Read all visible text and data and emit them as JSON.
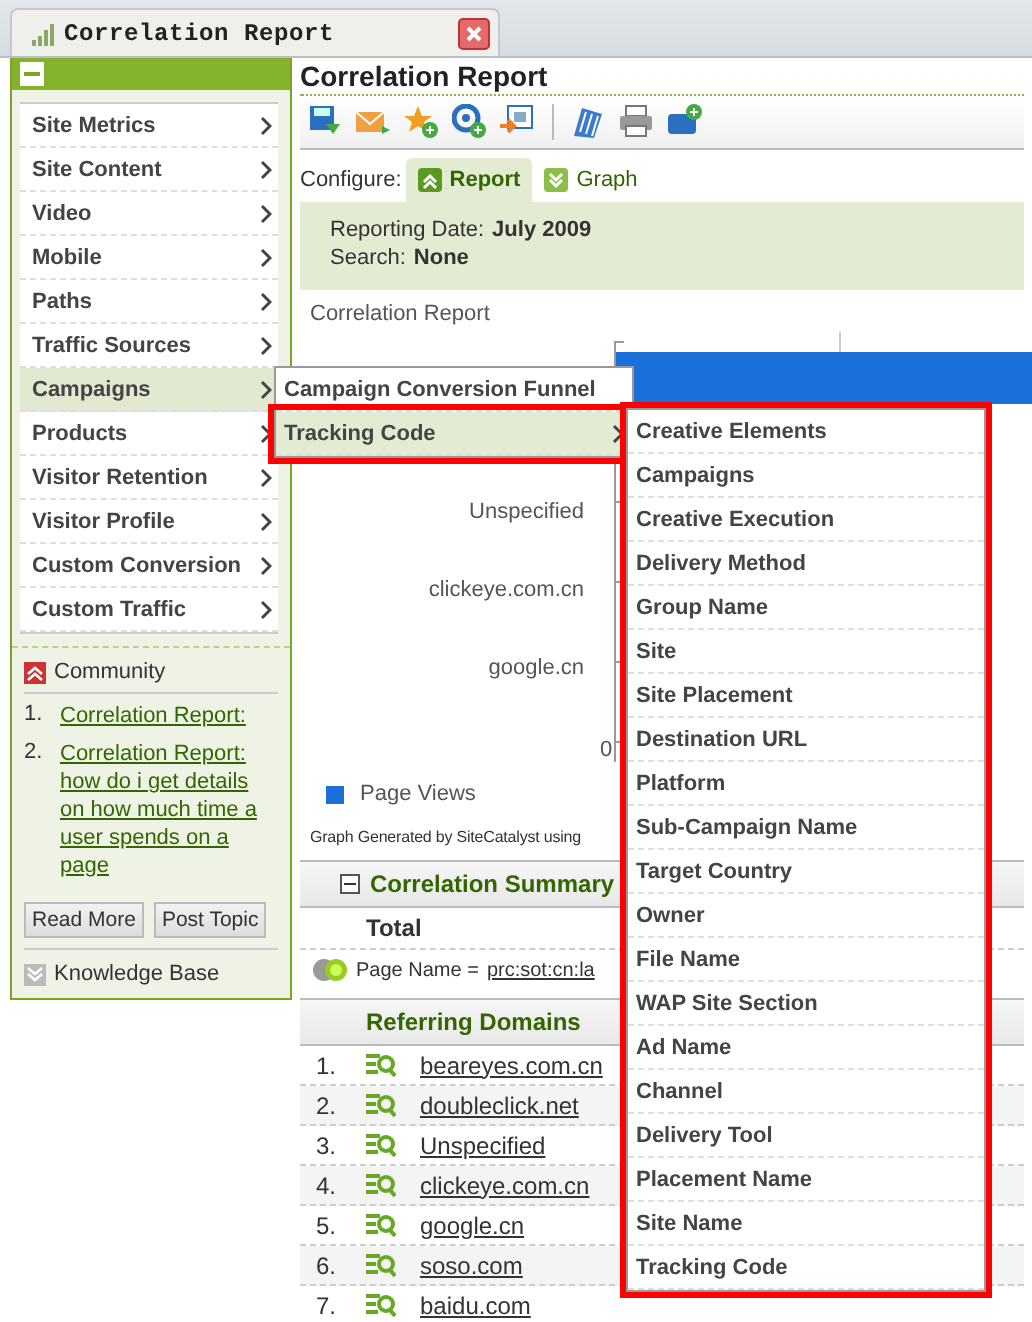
{
  "tab": {
    "title": "Correlation Report"
  },
  "sidebar": {
    "items": [
      {
        "label": "Site Metrics",
        "selected": false
      },
      {
        "label": "Site Content",
        "selected": false
      },
      {
        "label": "Video",
        "selected": false
      },
      {
        "label": "Mobile",
        "selected": false
      },
      {
        "label": "Paths",
        "selected": false
      },
      {
        "label": "Traffic Sources",
        "selected": false
      },
      {
        "label": "Campaigns",
        "selected": true
      },
      {
        "label": "Products",
        "selected": false
      },
      {
        "label": "Visitor Retention",
        "selected": false
      },
      {
        "label": "Visitor Profile",
        "selected": false
      },
      {
        "label": "Custom Conversion",
        "selected": false
      },
      {
        "label": "Custom Traffic",
        "selected": false
      }
    ],
    "community": {
      "title": "Community",
      "links": [
        {
          "number": "1.",
          "text": "Correlation Report:"
        },
        {
          "number": "2.",
          "text": "Correlation Report: how do i get details on how much time a user spends on a page"
        }
      ]
    },
    "buttons": [
      "Read More",
      "Post Topic"
    ],
    "knowledge_base": "Knowledge Base"
  },
  "main": {
    "title": "Correlation Report",
    "configure": {
      "label": "Configure:",
      "tabs": [
        {
          "label": "Report",
          "selected": true
        },
        {
          "label": "Graph",
          "selected": false
        }
      ]
    },
    "info": [
      {
        "label": "Reporting Date:",
        "value": "July 2009"
      },
      {
        "label": "Search:",
        "value": "None"
      }
    ],
    "chart": {
      "title": "Correlation Report",
      "labels": [
        "Unspecified",
        "clickeye.com.cn",
        "google.cn"
      ],
      "tick": "0",
      "legend": "Page Views",
      "footer": "Graph Generated by SiteCatalyst using"
    },
    "summary": {
      "title": "Correlation Summary",
      "total": "Total",
      "page_name_label": "Page Name =",
      "page_name_value": "prc:sot:cn:la"
    },
    "domains": {
      "title": "Referring Domains",
      "rows": [
        {
          "number": "1.",
          "name": "beareyes.com.cn"
        },
        {
          "number": "2.",
          "name": "doubleclick.net"
        },
        {
          "number": "3.",
          "name": "Unspecified"
        },
        {
          "number": "4.",
          "name": "clickeye.com.cn"
        },
        {
          "number": "5.",
          "name": "google.cn"
        },
        {
          "number": "6.",
          "name": "soso.com"
        },
        {
          "number": "7.",
          "name": "baidu.com"
        }
      ]
    }
  },
  "menus": [
    {
      "highlighted": false,
      "items": [
        {
          "label": "Campaign Conversion Funnel",
          "selected": false,
          "highlighted": false,
          "has_submenu": false
        },
        {
          "label": "Tracking Code",
          "selected": true,
          "highlighted": true,
          "has_submenu": true
        }
      ]
    },
    {
      "highlighted": true,
      "items": [
        {
          "label": "Creative Elements",
          "selected": false,
          "highlighted": false,
          "has_submenu": false
        },
        {
          "label": "Campaigns",
          "selected": false,
          "highlighted": false,
          "has_submenu": false
        },
        {
          "label": "Creative Execution",
          "selected": false,
          "highlighted": false,
          "has_submenu": false
        },
        {
          "label": "Delivery Method",
          "selected": false,
          "highlighted": false,
          "has_submenu": false
        },
        {
          "label": "Group Name",
          "selected": false,
          "highlighted": false,
          "has_submenu": false
        },
        {
          "label": "Site",
          "selected": false,
          "highlighted": false,
          "has_submenu": false
        },
        {
          "label": "Site Placement",
          "selected": false,
          "highlighted": false,
          "has_submenu": false
        },
        {
          "label": "Destination URL",
          "selected": false,
          "highlighted": false,
          "has_submenu": false
        },
        {
          "label": "Platform",
          "selected": false,
          "highlighted": false,
          "has_submenu": false
        },
        {
          "label": "Sub-Campaign Name",
          "selected": false,
          "highlighted": false,
          "has_submenu": false
        },
        {
          "label": "Target Country",
          "selected": false,
          "highlighted": false,
          "has_submenu": false
        },
        {
          "label": "Owner",
          "selected": false,
          "highlighted": false,
          "has_submenu": false
        },
        {
          "label": "File Name",
          "selected": false,
          "highlighted": false,
          "has_submenu": false
        },
        {
          "label": "WAP Site Section",
          "selected": false,
          "highlighted": false,
          "has_submenu": false
        },
        {
          "label": "Ad Name",
          "selected": false,
          "highlighted": false,
          "has_submenu": false
        },
        {
          "label": "Channel",
          "selected": false,
          "highlighted": false,
          "has_submenu": false
        },
        {
          "label": "Delivery Tool",
          "selected": false,
          "highlighted": false,
          "has_submenu": false
        },
        {
          "label": "Placement Name",
          "selected": false,
          "highlighted": false,
          "has_submenu": false
        },
        {
          "label": "Site Name",
          "selected": false,
          "highlighted": false,
          "has_submenu": false
        },
        {
          "label": "Tracking Code",
          "selected": false,
          "highlighted": false,
          "has_submenu": false
        }
      ]
    }
  ]
}
